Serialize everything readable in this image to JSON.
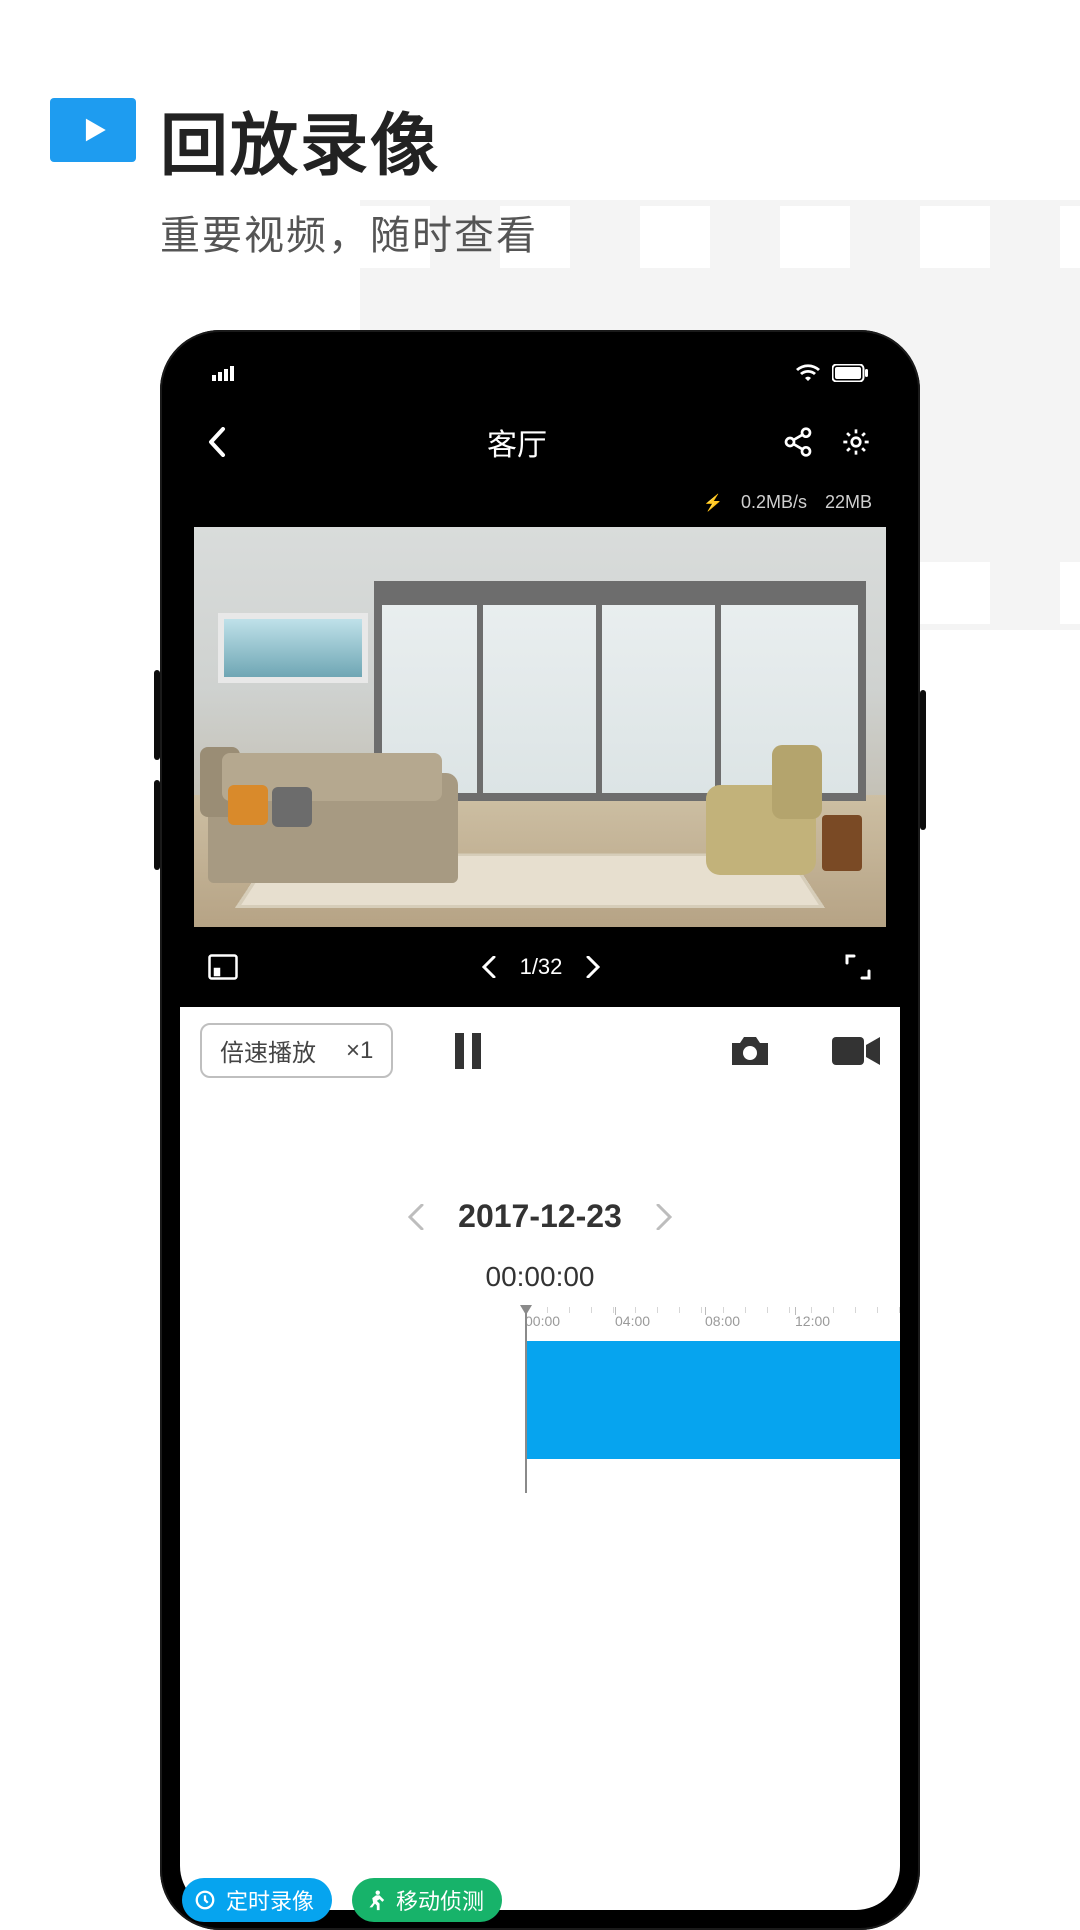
{
  "marketing": {
    "title": "回放录像",
    "subtitle": "重要视频，随时查看"
  },
  "app": {
    "header": {
      "title": "客厅"
    },
    "stats": {
      "speed": "0.2MB/s",
      "total": "22MB"
    },
    "pager": {
      "current": 1,
      "total": 32,
      "display": "1/32"
    },
    "controls": {
      "speed_label": "倍速播放",
      "speed_value": "×1"
    },
    "date": "2017-12-23",
    "time": "00:00:00",
    "timeline": {
      "ticks": [
        "00:00",
        "04:00",
        "08:00",
        "12:00"
      ]
    },
    "legend": {
      "scheduled": "定时录像",
      "motion": "移动侦测"
    }
  }
}
